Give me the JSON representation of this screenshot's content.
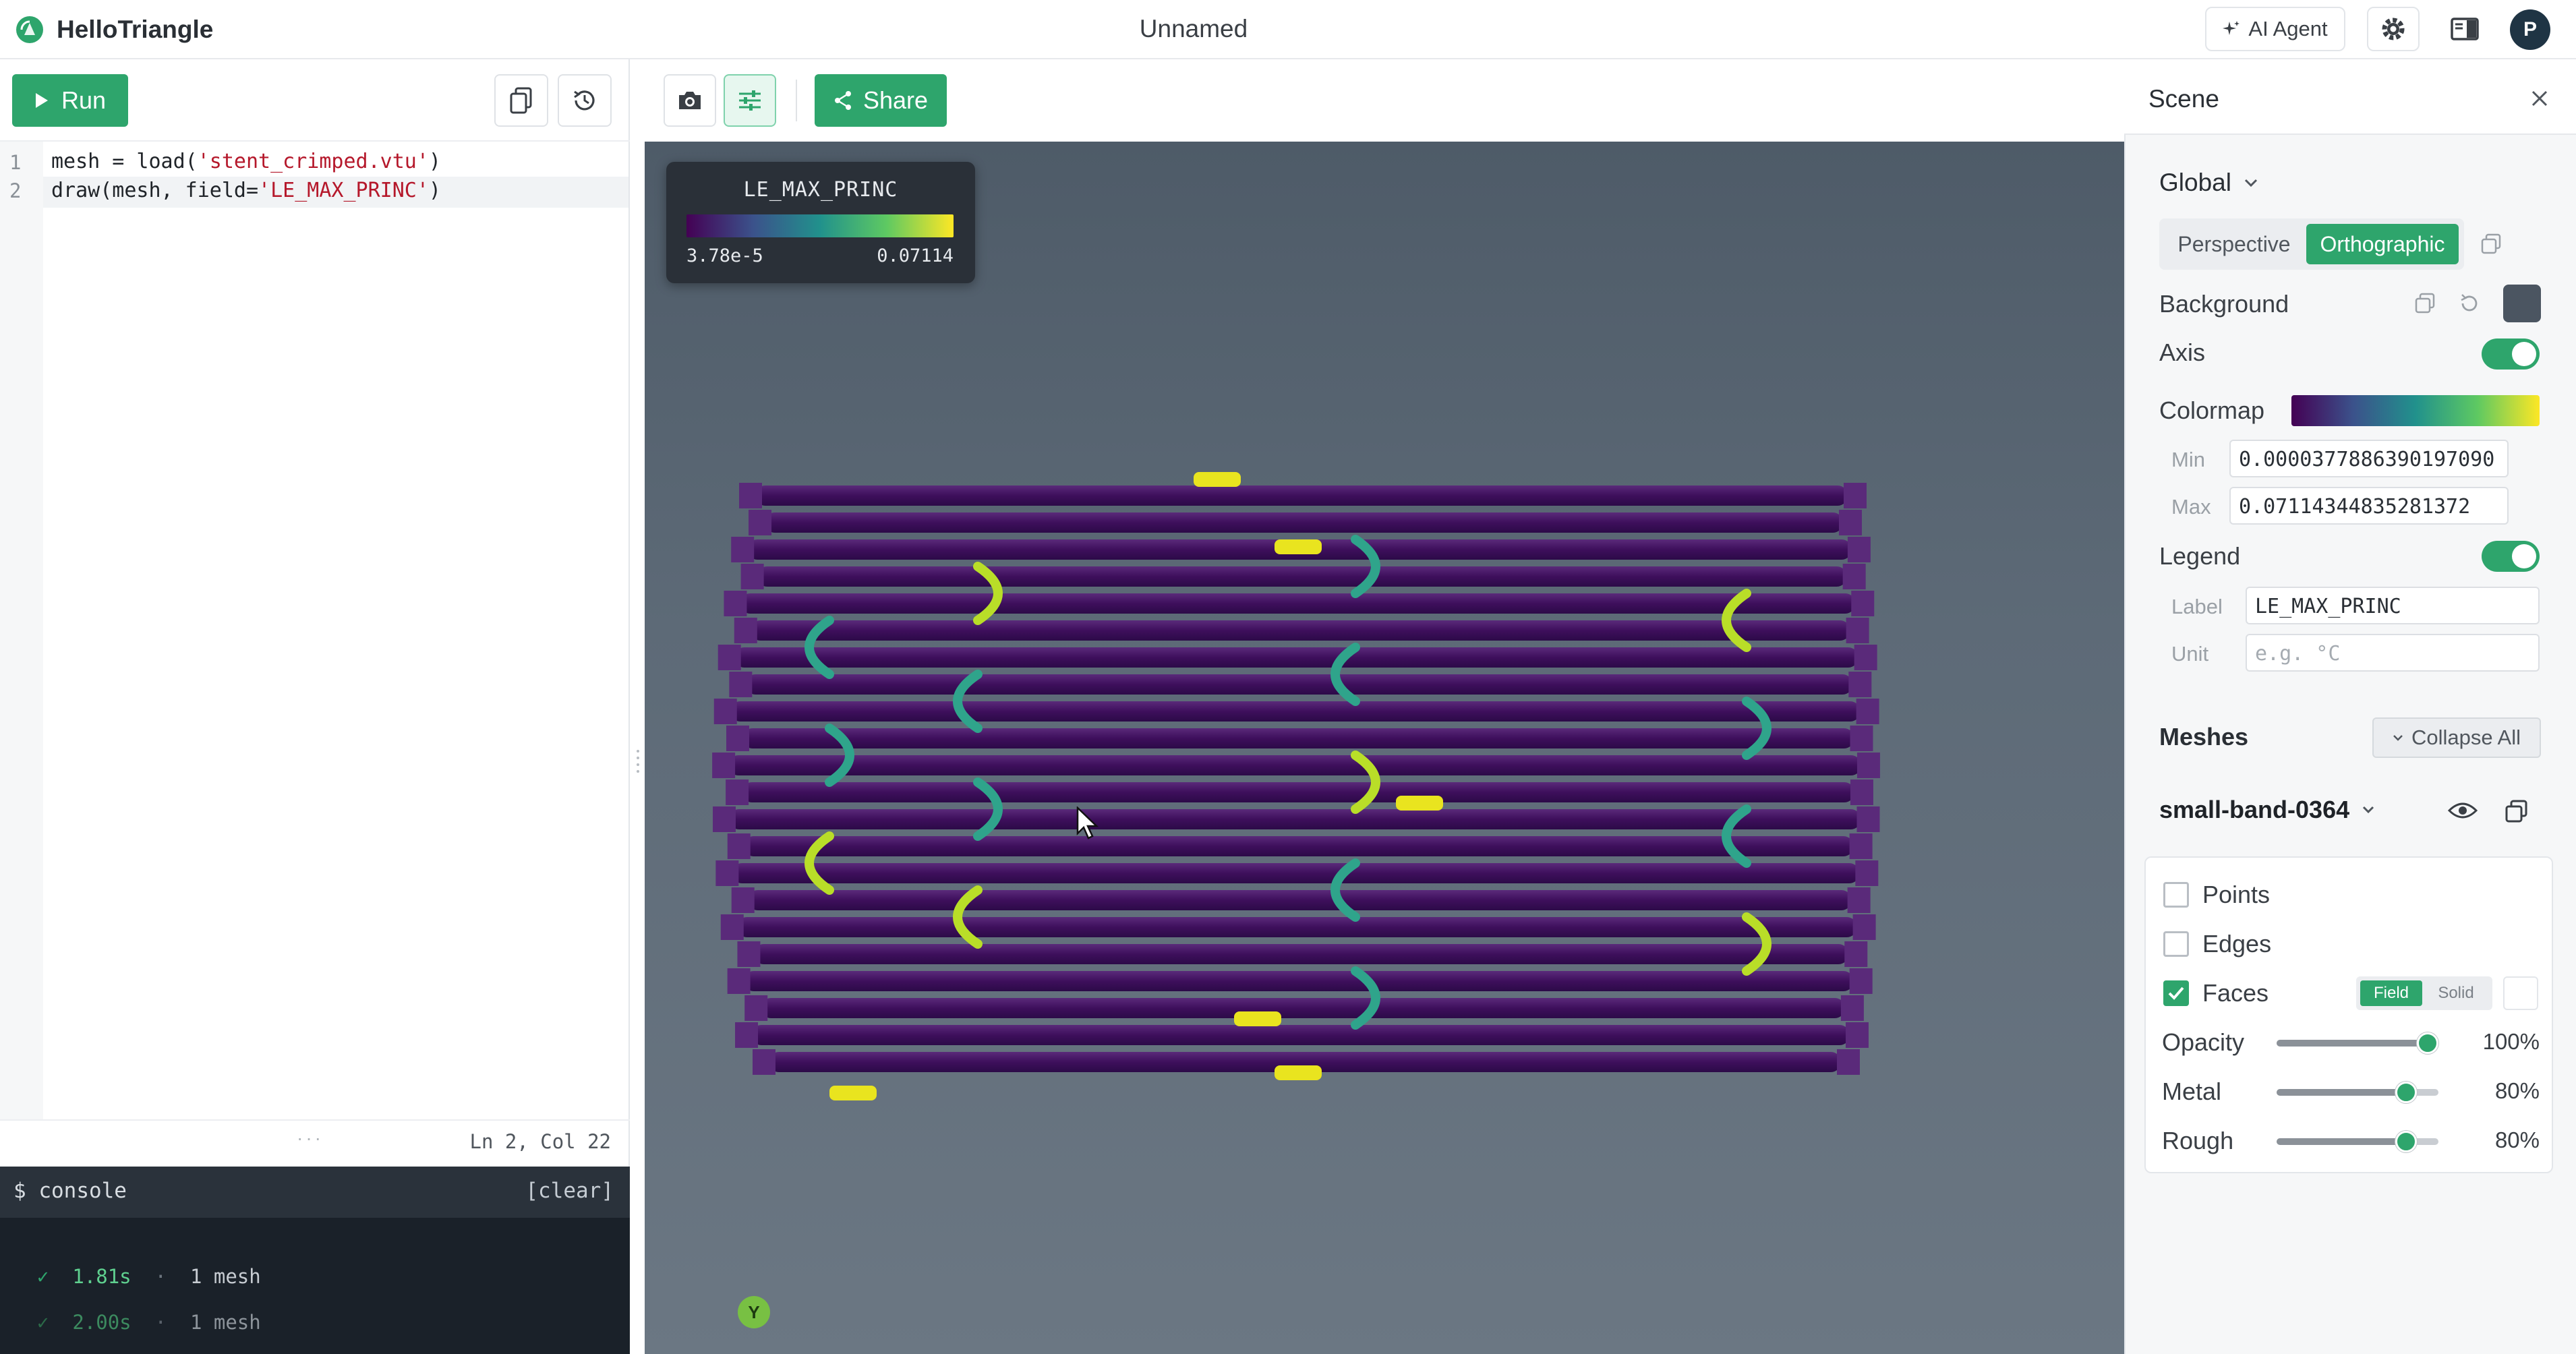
{
  "app": {
    "name": "HelloTriangle",
    "document_title": "Unnamed",
    "ai_agent_label": "AI Agent",
    "avatar_initial": "P"
  },
  "editor": {
    "run_label": "Run",
    "lines": [
      {
        "no": "1",
        "pre": "mesh = load(",
        "str": "'stent_crimped.vtu'",
        "post": ")"
      },
      {
        "no": "2",
        "pre": "draw(mesh, field=",
        "str": "'LE_MAX_PRINC'",
        "post": ")"
      }
    ],
    "cursor_position": "Ln 2, Col 22"
  },
  "console": {
    "title": "$ console",
    "clear_label": "[clear]",
    "entries": [
      {
        "check": "✓",
        "time": "1.81s",
        "sep": "·",
        "result": "1 mesh"
      },
      {
        "check": "✓",
        "time": "2.00s",
        "sep": "·",
        "result": "1 mesh"
      }
    ]
  },
  "viewport": {
    "share_label": "Share",
    "legend": {
      "title": "LE_MAX_PRINC",
      "min": "3.78e-5",
      "max": "0.07114"
    },
    "axis_label": "Y"
  },
  "scene": {
    "title": "Scene",
    "global": {
      "title": "Global",
      "projection_options": [
        "Perspective",
        "Orthographic"
      ],
      "projection_selected": "Orthographic",
      "background_label": "Background",
      "background_color": "#4b5561",
      "axis_label": "Axis",
      "axis_on": true,
      "colormap_label": "Colormap",
      "min_label": "Min",
      "min_value": "0.0000377886390197090",
      "max_label": "Max",
      "max_value": "0.07114344835281372",
      "legend_label": "Legend",
      "legend_on": true,
      "label_label": "Label",
      "label_value": "LE_MAX_PRINC",
      "unit_label": "Unit",
      "unit_placeholder": "e.g. °C"
    },
    "meshes": {
      "title": "Meshes",
      "collapse_all_label": "Collapse All",
      "mesh_name": "small-band-0364",
      "points_label": "Points",
      "points_checked": false,
      "edges_label": "Edges",
      "edges_checked": false,
      "faces_label": "Faces",
      "faces_checked": true,
      "mode_field": "Field",
      "mode_solid": "Solid",
      "opacity_label": "Opacity",
      "opacity_value": "100%",
      "opacity_level": 1.0,
      "metal_label": "Metal",
      "metal_value": "80%",
      "metal_level": 0.8,
      "rough_label": "Rough",
      "rough_value": "80%",
      "rough_level": 0.8
    }
  },
  "colors": {
    "accent": "#2ea56c",
    "viewport_bg": "#57636f"
  }
}
